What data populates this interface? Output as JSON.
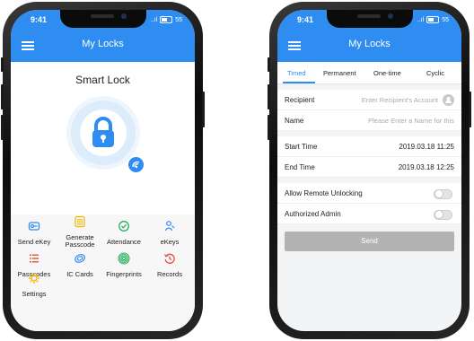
{
  "status": {
    "time": "9:41",
    "signal": "..ıl",
    "battery": "55"
  },
  "left": {
    "app_title": "My Locks",
    "lock_name": "Smart Lock",
    "icons": {
      "lock": "padlock-icon",
      "wifi": "remote-signal-icon"
    },
    "features": [
      {
        "label": "Send eKey",
        "icon": "send-ekey-icon",
        "color": "#2f8cf0"
      },
      {
        "label": "Generate Passcode",
        "icon": "generate-passcode-icon",
        "color": "#f2b705"
      },
      {
        "label": "Attendance",
        "icon": "attendance-icon",
        "color": "#27ae60"
      },
      {
        "label": "eKeys",
        "icon": "ekeys-icon",
        "color": "#2f8cf0"
      },
      {
        "label": "Passcodes",
        "icon": "passcodes-icon",
        "color": "#e74c3c"
      },
      {
        "label": "IC Cards",
        "icon": "ic-cards-icon",
        "color": "#2f8cf0"
      },
      {
        "label": "Fingerprints",
        "icon": "fingerprints-icon",
        "color": "#27ae60"
      },
      {
        "label": "Records",
        "icon": "records-icon",
        "color": "#e74c3c"
      },
      {
        "label": "Settings",
        "icon": "settings-icon",
        "color": "#f2b705"
      }
    ]
  },
  "right": {
    "app_title": "My Locks",
    "tabs": [
      {
        "label": "Timed",
        "active": true
      },
      {
        "label": "Permanent",
        "active": false
      },
      {
        "label": "One-time",
        "active": false
      },
      {
        "label": "Cyclic",
        "active": false
      }
    ],
    "recipient": {
      "label": "Recipient",
      "placeholder": "Enter Recipient's Account"
    },
    "name": {
      "label": "Name",
      "placeholder": "Please Enter a Name for this"
    },
    "start_time": {
      "label": "Start Time",
      "value": "2019.03.18 11:25"
    },
    "end_time": {
      "label": "End Time",
      "value": "2019.03.18 12:25"
    },
    "remote_unlocking": {
      "label": "Allow Remote Unlocking",
      "on": false
    },
    "authorized_admin": {
      "label": "Authorized Admin",
      "on": false
    },
    "send_label": "Send"
  },
  "colors": {
    "accent": "#2f8cf0",
    "disabled_button": "#b3b3b3"
  }
}
